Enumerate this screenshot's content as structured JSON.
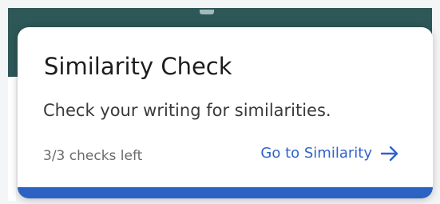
{
  "card": {
    "title": "Similarity Check",
    "description": "Check your writing for similarities.",
    "checks_left": "3/3 checks left",
    "link_label": "Go to Similarity",
    "link_icon": "arrow-right-icon"
  },
  "colors": {
    "banner": "#2e5757",
    "accent_blue": "#2b62c4",
    "link_blue": "#2f63c9"
  }
}
